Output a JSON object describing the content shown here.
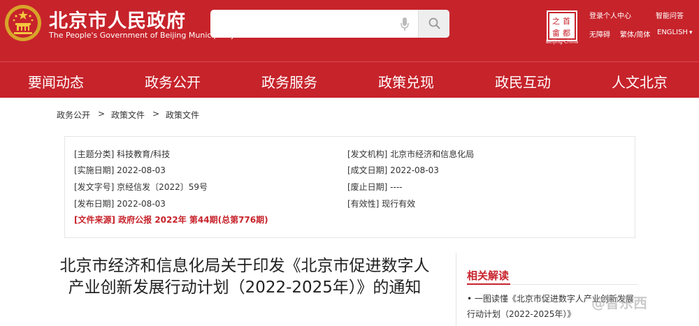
{
  "header": {
    "title": "北京市人民政府",
    "subtitle": "The People's Government of Beijing Municipality",
    "search": {
      "placeholder": ""
    },
    "seal": {
      "caption": "Beijing·China"
    },
    "links": {
      "login": "登录个人中心",
      "smart_qa": "智能问答",
      "accessibility": "无障碍",
      "traditional": "繁体/简体",
      "language": "ENGLISH"
    }
  },
  "nav": {
    "items": [
      "要闻动态",
      "政务公开",
      "政务服务",
      "政策兑现",
      "政民互动",
      "人文北京"
    ]
  },
  "breadcrumb": [
    "政务公开",
    ">",
    "政策文件",
    ">",
    "政策文件"
  ],
  "meta": {
    "left": [
      "[主题分类] 科技教育/科技",
      "[实施日期] 2022-08-03",
      "[发文字号] 京经信发〔2022〕59号",
      "[发布日期] 2022-08-03"
    ],
    "right": [
      "[发文机构] 北京市经济和信息化局",
      "[成文日期] 2022-08-03",
      "[废止日期] ----",
      "[有效性] 现行有效"
    ],
    "source": "[文件来源] 政府公报 2022年 第44期(总第776期)"
  },
  "article": {
    "title": "北京市经济和信息化局关于印发《北京市促进数字人产业创新发展行动计划（2022-2025年）》的通知"
  },
  "related": {
    "heading": "相关解读",
    "items": [
      "• 一图读懂《北京市促进数字人产业创新发展行动计划（2022-2025年）》"
    ]
  },
  "watermark": "@智东西",
  "colors": {
    "brand_red": "#c7232b",
    "nav_red": "#c7232b"
  }
}
